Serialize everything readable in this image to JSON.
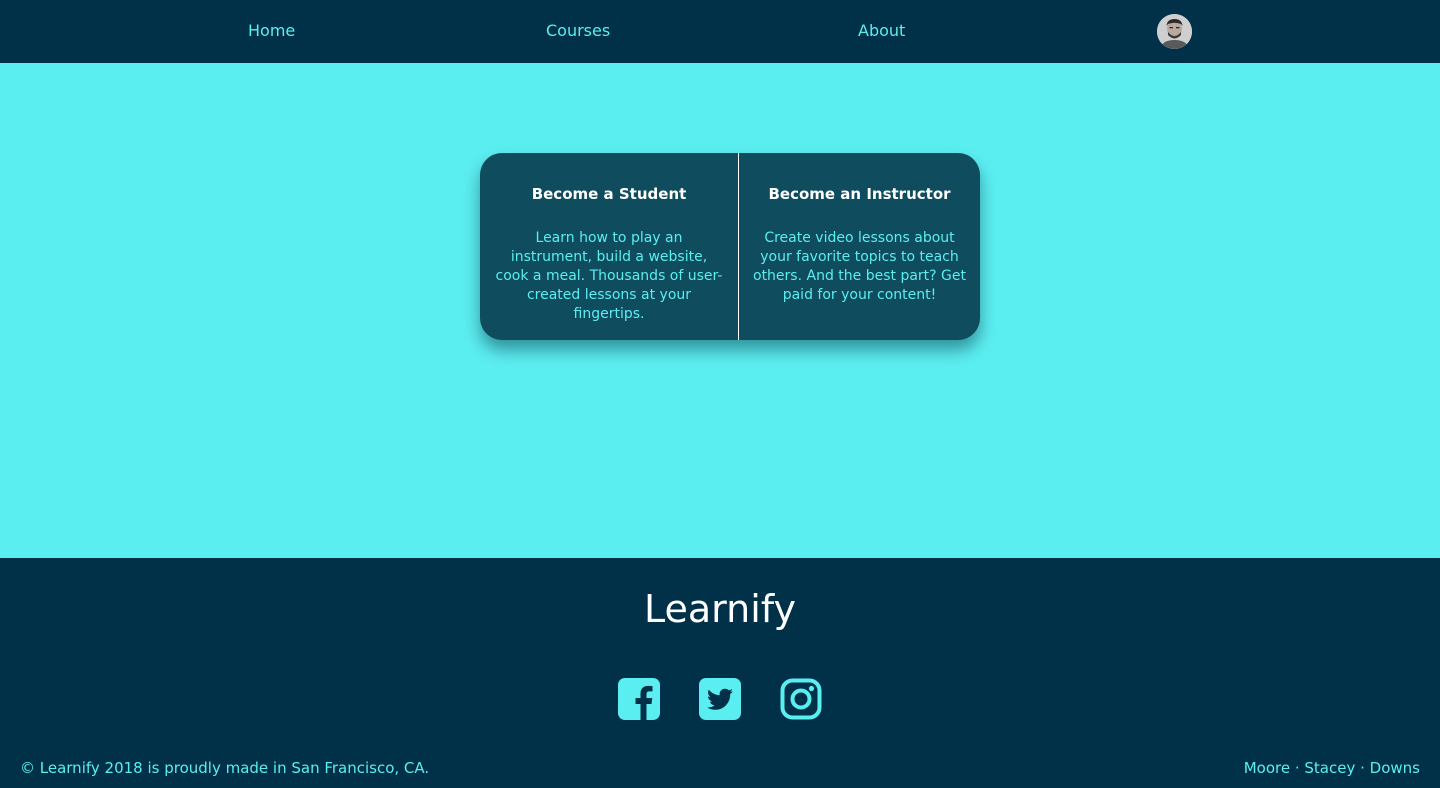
{
  "nav": {
    "links": [
      {
        "label": "Home"
      },
      {
        "label": "Courses"
      },
      {
        "label": "About"
      }
    ],
    "avatar_icon": "user-avatar"
  },
  "cards": [
    {
      "title": "Become a Student",
      "text": "Learn how to play an instrument, build a website, cook a meal. Thousands of user-created lessons at your fingertips."
    },
    {
      "title": "Become an Instructor",
      "text": "Create video lessons about your favorite topics to teach others. And the best part? Get paid for your content!"
    }
  ],
  "footer": {
    "brand": "Learnify",
    "social_icons": [
      "facebook-icon",
      "twitter-icon",
      "instagram-icon"
    ],
    "copyright": "© Learnify 2018 is proudly made in San Francisco, CA.",
    "credits": [
      "Moore",
      "Stacey",
      "Downs"
    ],
    "separator": " · "
  },
  "colors": {
    "nav_bg": "#003148",
    "main_bg": "#5BEEF1",
    "card_bg": "#0E4C5E",
    "accent": "#5BEEF1",
    "white": "#FFFFFF"
  }
}
